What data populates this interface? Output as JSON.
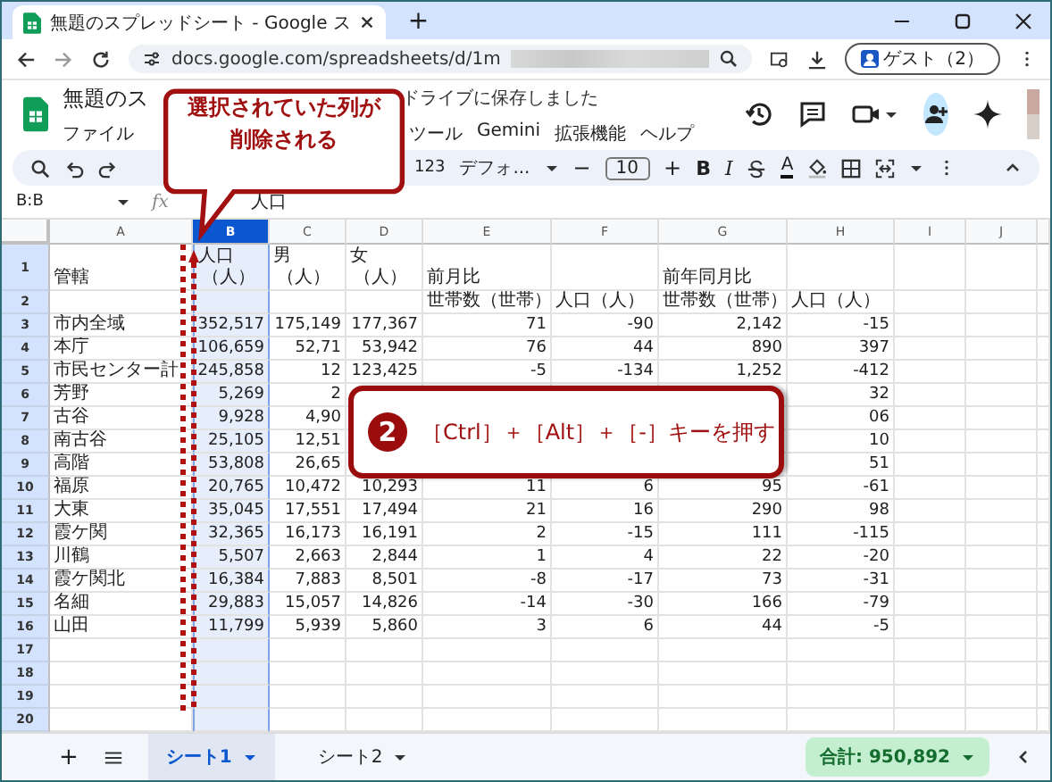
{
  "browser": {
    "tab_title": "無題のスプレッドシート - Google ス",
    "new_tab": "+",
    "url": "docs.google.com/spreadsheets/d/1m",
    "profile": "ゲスト（2）"
  },
  "app": {
    "title": "無題のス",
    "save_status": "ドライブに保存しました",
    "menus": [
      {
        "label": "ファイル"
      },
      {
        "label": "ツール"
      },
      {
        "label": "Gemini"
      },
      {
        "label": "拡張機能"
      },
      {
        "label": "ヘルプ"
      }
    ]
  },
  "toolbar": {
    "number_format": "123",
    "font": "デフォ...",
    "minus": "−",
    "font_size": "10",
    "plus": "+",
    "bold": "B",
    "italic": "I",
    "text_color": "A"
  },
  "formula_bar": {
    "cell_ref": "B:B",
    "fx": "fx",
    "value": "人口"
  },
  "sheet": {
    "columns": [
      {
        "label": "A",
        "selected": false
      },
      {
        "label": "B",
        "selected": true
      },
      {
        "label": "C",
        "selected": false
      },
      {
        "label": "D",
        "selected": false
      },
      {
        "label": "E",
        "selected": false
      },
      {
        "label": "F",
        "selected": false
      },
      {
        "label": "G",
        "selected": false
      },
      {
        "label": "H",
        "selected": false
      },
      {
        "label": "I",
        "selected": false
      },
      {
        "label": "J",
        "selected": false
      }
    ],
    "rows": [
      {
        "number": "1",
        "kind": "header",
        "cells": [
          "管轄",
          [
            "人口",
            "（人）"
          ],
          [
            "男",
            "（人）"
          ],
          [
            "女",
            "（人）"
          ],
          "前月比",
          null,
          "前年同月比",
          null
        ]
      },
      {
        "number": "2",
        "kind": "header",
        "cells": [
          null,
          null,
          null,
          null,
          "世帯数（世帯）",
          "人口（人）",
          "世帯数（世帯）",
          "人口（人）"
        ]
      },
      {
        "number": "3",
        "kind": "data",
        "cells": [
          "市内全域",
          "352,517",
          "175,149",
          "177,367",
          "71",
          "-90",
          "2,142",
          "-15"
        ]
      },
      {
        "number": "4",
        "kind": "data",
        "cells": [
          "本庁",
          "106,659",
          "52,71",
          "53,942",
          "76",
          "44",
          "890",
          "397"
        ]
      },
      {
        "number": "5",
        "kind": "data",
        "cells": [
          "市民センター計",
          "245,858",
          "12",
          "123,425",
          "-5",
          "-134",
          "1,252",
          "-412"
        ]
      },
      {
        "number": "6",
        "kind": "data",
        "cells": [
          "芳野",
          "5,269",
          "2",
          null,
          null,
          null,
          null,
          "32"
        ]
      },
      {
        "number": "7",
        "kind": "data",
        "cells": [
          "古谷",
          "9,928",
          "4,90",
          null,
          null,
          null,
          null,
          "06"
        ]
      },
      {
        "number": "8",
        "kind": "data",
        "cells": [
          "南古谷",
          "25,105",
          "12,51",
          null,
          null,
          null,
          null,
          "10"
        ]
      },
      {
        "number": "9",
        "kind": "data",
        "cells": [
          "高階",
          "53,808",
          "26,65",
          null,
          null,
          null,
          null,
          "51"
        ]
      },
      {
        "number": "10",
        "kind": "data",
        "cells": [
          "福原",
          "20,765",
          "10,472",
          "10,293",
          "11",
          "6",
          "95",
          "-61"
        ]
      },
      {
        "number": "11",
        "kind": "data",
        "cells": [
          "大東",
          "35,045",
          "17,551",
          "17,494",
          "21",
          "16",
          "290",
          "98"
        ]
      },
      {
        "number": "12",
        "kind": "data",
        "cells": [
          "霞ケ関",
          "32,365",
          "16,173",
          "16,191",
          "2",
          "-15",
          "111",
          "-115"
        ]
      },
      {
        "number": "13",
        "kind": "data",
        "cells": [
          "川鶴",
          "5,507",
          "2,663",
          "2,844",
          "1",
          "4",
          "22",
          "-20"
        ]
      },
      {
        "number": "14",
        "kind": "data",
        "cells": [
          "霞ケ関北",
          "16,384",
          "7,883",
          "8,501",
          "-8",
          "-17",
          "73",
          "-31"
        ]
      },
      {
        "number": "15",
        "kind": "data",
        "cells": [
          "名細",
          "29,883",
          "15,057",
          "14,826",
          "-14",
          "-30",
          "166",
          "-79"
        ]
      },
      {
        "number": "16",
        "kind": "data",
        "cells": [
          "山田",
          "11,799",
          "5,939",
          "5,860",
          "3",
          "6",
          "44",
          "-5"
        ]
      },
      {
        "number": "17",
        "cells": []
      },
      {
        "number": "18",
        "cells": []
      },
      {
        "number": "19",
        "cells": []
      },
      {
        "number": "20",
        "cells": []
      }
    ]
  },
  "sheet_tabs": {
    "add": "+",
    "tabs": [
      {
        "label": "シート1",
        "selected": true
      },
      {
        "label": "シート2",
        "selected": false
      }
    ],
    "sum": "合計: 950,892"
  },
  "callouts": [
    {
      "kind": "speech",
      "lines": [
        "選択されていた列が",
        "削除される"
      ]
    },
    {
      "kind": "step",
      "number": "2",
      "text": "［Ctrl］＋［Alt］＋［-］キーを押す"
    }
  ]
}
